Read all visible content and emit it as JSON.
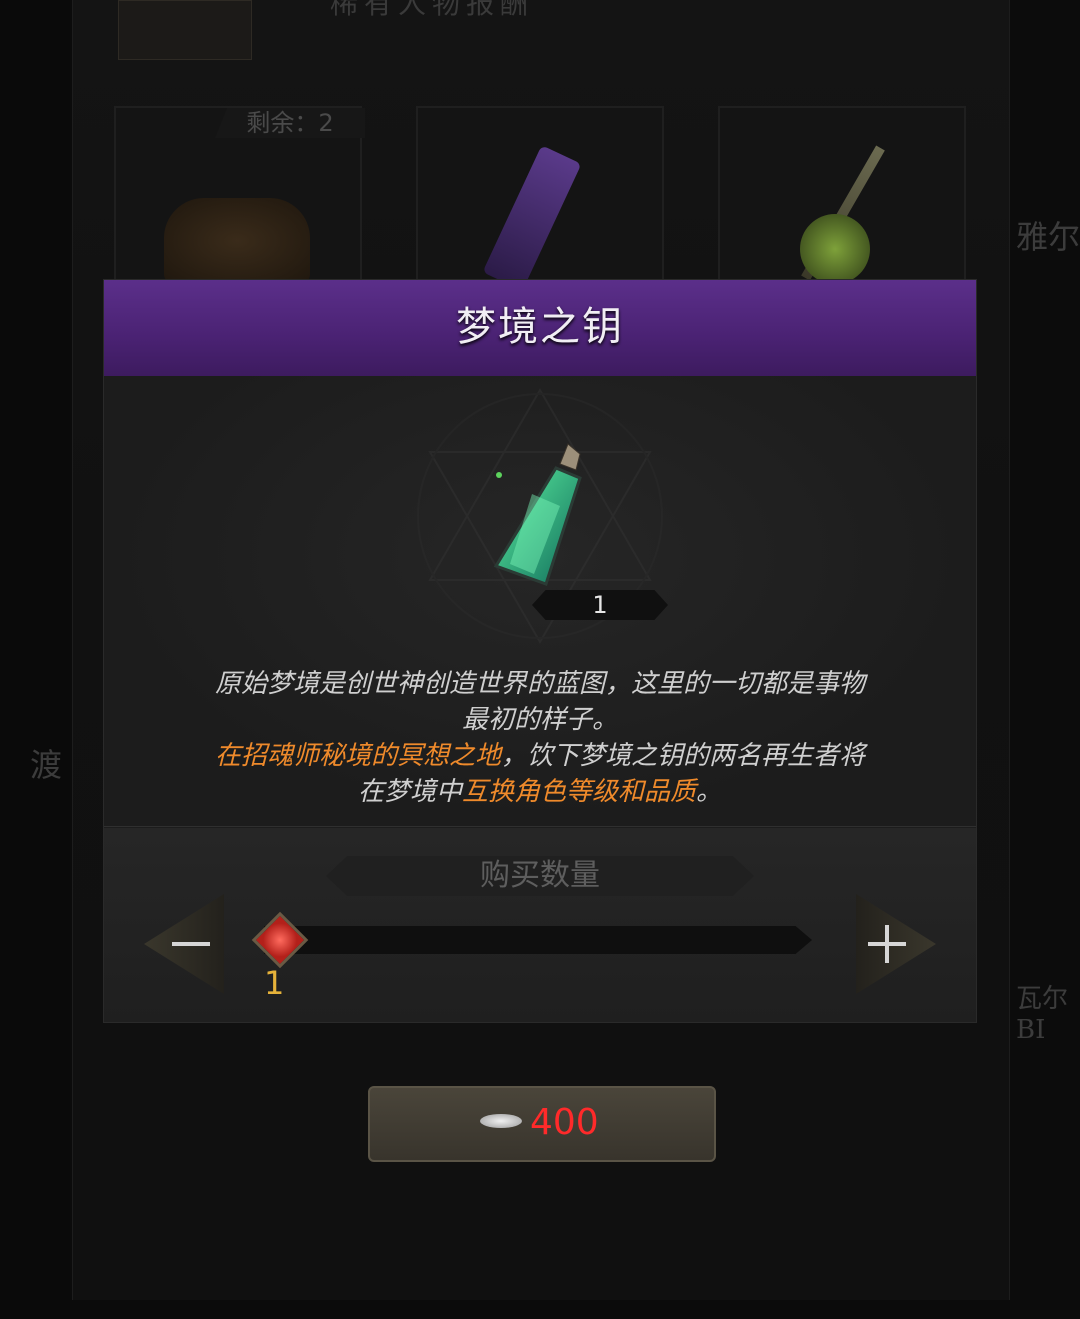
{
  "background": {
    "top_title": "稀有人物报酬",
    "remaining": "剩余：2",
    "side_left_char": "渡",
    "side_right_text_1": "雅尔",
    "side_right_text_2": "瓦尔BI"
  },
  "modal": {
    "title": "梦境之钥",
    "item_icon": "green-potion-icon",
    "count": "1",
    "description": {
      "line1": "原始梦境是创世神创造世界的蓝图，这里的一切都是事物",
      "line2": "最初的样子。",
      "line3_prefix": "在",
      "line3_highlight": "招魂师秘境的冥想之地",
      "line3_suffix": "，饮下梦境之钥的两名再生者将",
      "line4_prefix": "在梦境中",
      "line4_highlight": "互换角色等级和品质",
      "line4_suffix": "。"
    },
    "quantity": {
      "label": "购买数量",
      "value": "1",
      "fraction": 0
    }
  },
  "buy": {
    "currency_icon": "silver-coin-icon",
    "price": "400"
  },
  "colors": {
    "header_purple": "#4a2273",
    "highlight_orange": "#ef8a2b",
    "price_red": "#ff2a2a",
    "qty_gold": "#e6b23a"
  }
}
